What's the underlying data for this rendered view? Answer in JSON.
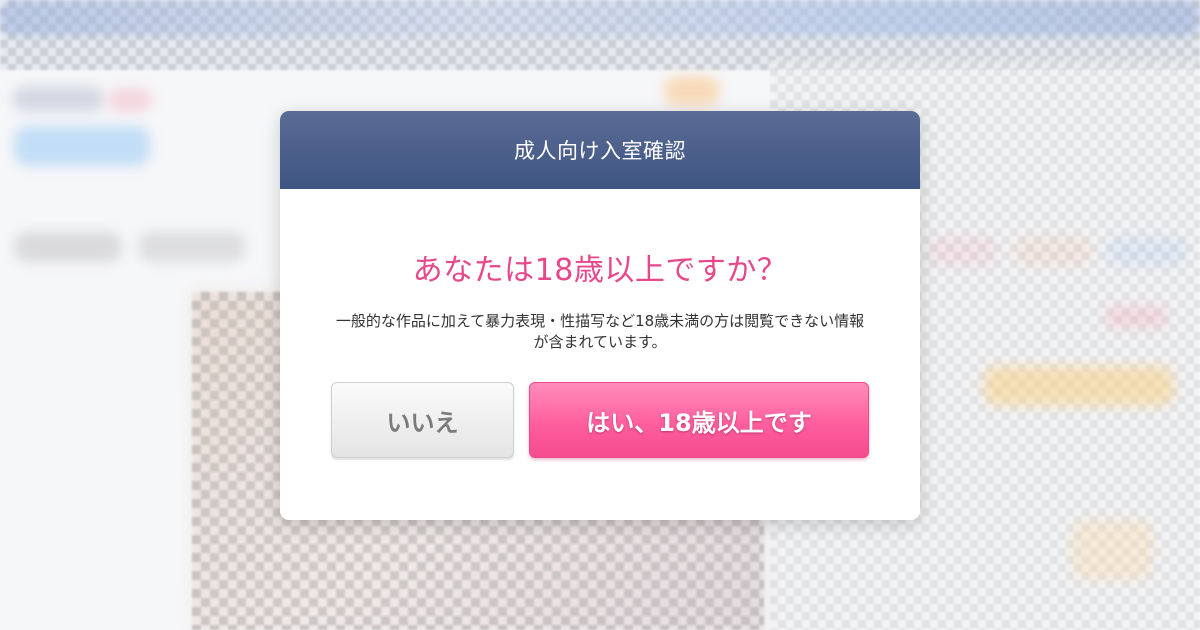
{
  "modal": {
    "title": "成人向け入室確認",
    "question": "あなたは18歳以上ですか？",
    "description": "一般的な作品に加えて暴力表現・性描写など18歳未満の方は閲覧できない情報が含まれています。",
    "no_button": "いいえ",
    "yes_button": "はい、18歳以上です"
  },
  "colors": {
    "header": "#4a5e8c",
    "question": "#e8478b",
    "yes_button": "#ff5f9e",
    "no_button": "#e8e8e8"
  }
}
